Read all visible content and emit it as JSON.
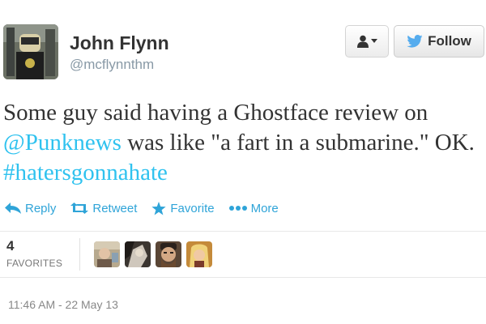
{
  "user": {
    "display_name": "John Flynn",
    "screen_name": "@mcflynnthm"
  },
  "header": {
    "follow_label": "Follow",
    "user_menu_icon": "person-dropdown-icon",
    "follow_icon": "twitter-bird-icon"
  },
  "tweet": {
    "text_start": "Some guy said having a Ghostface review on ",
    "mention": "@Punknews",
    "text_middle": " was like \"a fart in a submarine.\" OK. ",
    "hashtag": "#hatersgonnahate",
    "link_color": "#2fc2ef"
  },
  "actions": [
    {
      "label": "Reply",
      "icon": "reply-arrow-icon"
    },
    {
      "label": "Retweet",
      "icon": "retweet-icon"
    },
    {
      "label": "Favorite",
      "icon": "star-icon"
    },
    {
      "label": "More",
      "icon": "ellipsis-icon"
    }
  ],
  "stats": {
    "favorites_count": "4",
    "favorites_label": "FAVORITES"
  },
  "timestamp": "11:46 AM - 22 May 13",
  "colors": {
    "accent": "#2fa4d8",
    "twitter_blue": "#55acee",
    "text": "#333333",
    "muted": "#8899a6"
  }
}
